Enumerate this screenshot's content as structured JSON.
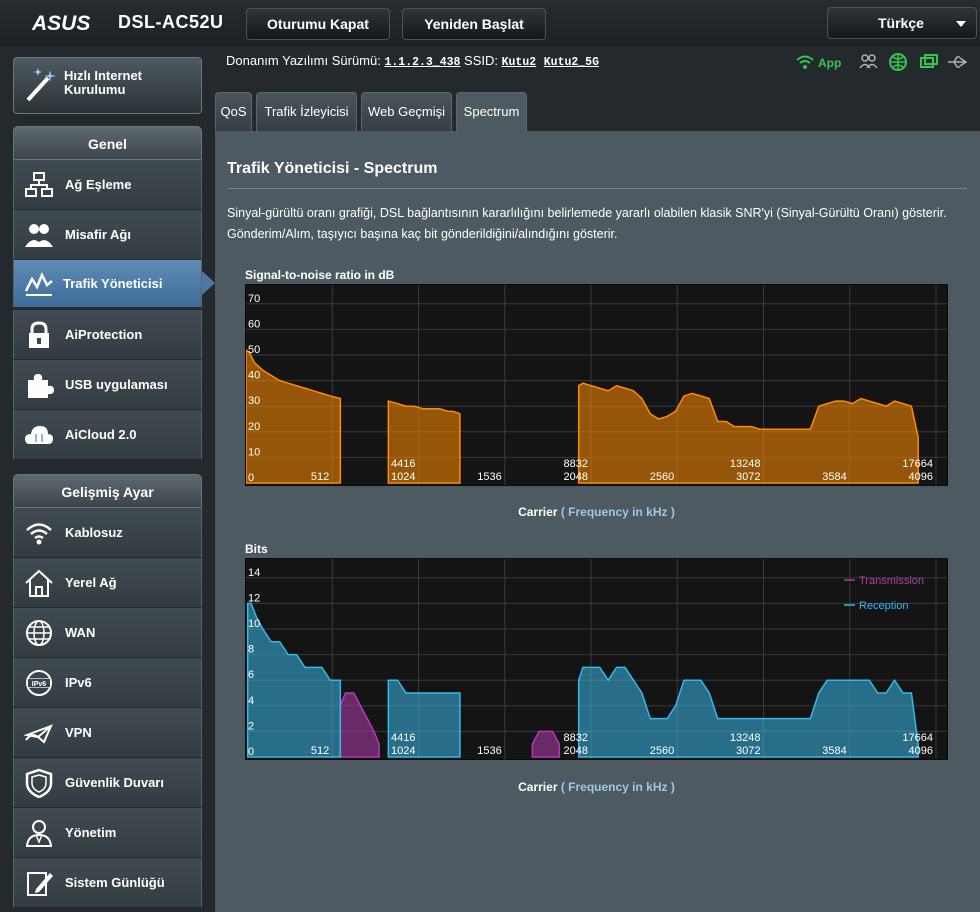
{
  "header": {
    "brand": "ASUS",
    "model": "DSL-AC52U",
    "logout_label": "Oturumu Kapat",
    "reboot_label": "Yeniden Başlat",
    "language": "Türkçe"
  },
  "firmware": {
    "label": "Donanım Yazılımı Sürümü:",
    "version": "1.1.2.3_438",
    "ssid_label": "SSID:",
    "ssid_1": "Kutu2",
    "ssid_2": "Kutu2_5G",
    "app_label": "App"
  },
  "sidebar": {
    "quick_setup": "Hızlı Internet Kurulumu",
    "general_title": "Genel",
    "general_items": [
      {
        "label": "Ağ Eşleme",
        "icon": "network-map-icon"
      },
      {
        "label": "Misafir Ağı",
        "icon": "guest-network-icon"
      },
      {
        "label": "Trafik Yöneticisi",
        "icon": "traffic-manager-icon",
        "active": true
      },
      {
        "label": "AiProtection",
        "icon": "lock-icon"
      },
      {
        "label": "USB uygulaması",
        "icon": "puzzle-icon"
      },
      {
        "label": "AiCloud 2.0",
        "icon": "cloud-icon"
      }
    ],
    "advanced_title": "Gelişmiş Ayar",
    "advanced_items": [
      {
        "label": "Kablosuz",
        "icon": "wifi-icon"
      },
      {
        "label": "Yerel Ağ",
        "icon": "home-icon"
      },
      {
        "label": "WAN",
        "icon": "globe-icon"
      },
      {
        "label": "IPv6",
        "icon": "ipv6-icon"
      },
      {
        "label": "VPN",
        "icon": "vpn-icon"
      },
      {
        "label": "Güvenlik Duvarı",
        "icon": "shield-icon"
      },
      {
        "label": "Yönetim",
        "icon": "admin-icon"
      },
      {
        "label": "Sistem Günlüğü",
        "icon": "log-icon"
      }
    ]
  },
  "tabs": [
    {
      "label": "QoS"
    },
    {
      "label": "Trafik İzleyicisi"
    },
    {
      "label": "Web Geçmişi"
    },
    {
      "label": "Spectrum",
      "active": true
    }
  ],
  "main": {
    "title": "Trafik Yöneticisi - Spectrum",
    "description": "Sinyal-gürültü oranı grafiği, DSL bağlantısının kararlılığını belirlemede yararlı olabilen klasik SNR'yi (Sinyal-Gürültü Oranı) gösterir. Gönderim/Alım, taşıyıcı başına kaç bit gönderildiğini/alındığını gösterir.",
    "carrier_label": "Carrier",
    "carrier_unit": "( Frequency in kHz )"
  },
  "chart_data": [
    {
      "type": "area",
      "title": "Signal-to-noise ratio in dB",
      "xlabel": "Carrier ( Frequency in kHz )",
      "ylim": [
        0,
        75
      ],
      "y_ticks": [
        "0",
        "10",
        "20",
        "30",
        "40",
        "50",
        "60",
        "70"
      ],
      "x_ticks": [
        "512",
        "1024",
        "1536",
        "2048",
        "2560",
        "3072",
        "3584",
        "4096"
      ],
      "freq_ticks": [
        "4416",
        "8832",
        "13248",
        "17664"
      ],
      "series": [
        {
          "color": "#ff8c00",
          "segments": [
            {
              "x": [
                0,
                20,
                50,
                100,
                150,
                200,
                250,
                300,
                350,
                400,
                450,
                500,
                560
              ],
              "y": [
                52,
                51,
                47,
                44,
                42,
                40,
                39,
                38,
                37,
                36,
                35,
                34,
                33
              ]
            },
            {
              "x": [
                845,
                900,
                950,
                1000,
                1050,
                1100,
                1150,
                1200,
                1230,
                1270
              ],
              "y": [
                32,
                31,
                30,
                30,
                29,
                29,
                29,
                28,
                28,
                27
              ]
            },
            {
              "x": [
                1975,
                2000,
                2050,
                2100,
                2150,
                2200,
                2250,
                2300,
                2350,
                2400,
                2450,
                2500,
                2550,
                2600,
                2650,
                2700,
                2750,
                2800,
                2850,
                2900,
                2950,
                3000,
                3050,
                3100,
                3150,
                3200,
                3250,
                3300,
                3350,
                3400,
                3450,
                3500,
                3550,
                3600,
                3650,
                3700,
                3750,
                3800,
                3850,
                3900,
                3950,
                3990
              ],
              "y": [
                38,
                39,
                38,
                37,
                36,
                38,
                37,
                36,
                33,
                27,
                25,
                26,
                28,
                34,
                35,
                34,
                33,
                24,
                24,
                22,
                22,
                22,
                21,
                21,
                21,
                21,
                21,
                21,
                21,
                30,
                31,
                32,
                32,
                31,
                33,
                32,
                31,
                30,
                32,
                31,
                30,
                18
              ]
            }
          ]
        }
      ]
    },
    {
      "type": "area",
      "title": "Bits",
      "xlabel": "Carrier ( Frequency in kHz )",
      "ylim": [
        0,
        15
      ],
      "y_ticks": [
        "0",
        "2",
        "4",
        "6",
        "8",
        "10",
        "12",
        "14"
      ],
      "x_ticks": [
        "512",
        "1024",
        "1536",
        "2048",
        "2560",
        "3072",
        "3584",
        "4096"
      ],
      "freq_ticks": [
        "4416",
        "8832",
        "13248",
        "17664"
      ],
      "series": [
        {
          "name": "Transmission",
          "color": "#b03cb0",
          "segments": [
            {
              "x": [
                560,
                590,
                640,
                680,
                720,
                760,
                790
              ],
              "y": [
                4,
                5,
                5,
                4,
                3,
                2,
                1
              ]
            },
            {
              "x": [
                1700,
                1740,
                1780,
                1820,
                1860
              ],
              "y": [
                1,
                2,
                2,
                2,
                1
              ]
            }
          ]
        },
        {
          "name": "Reception",
          "color": "#39b8e8",
          "segments": [
            {
              "x": [
                10,
                30,
                60,
                100,
                150,
                200,
                250,
                300,
                350,
                400,
                450,
                500,
                560
              ],
              "y": [
                12,
                12,
                11,
                10,
                9,
                9,
                8,
                8,
                7,
                7,
                7,
                6,
                6
              ]
            },
            {
              "x": [
                845,
                900,
                950,
                1000,
                1050,
                1100,
                1150,
                1200,
                1240,
                1270
              ],
              "y": [
                6,
                6,
                5,
                5,
                5,
                5,
                5,
                5,
                5,
                5
              ]
            },
            {
              "x": [
                1975,
                2000,
                2050,
                2100,
                2150,
                2200,
                2250,
                2300,
                2350,
                2400,
                2450,
                2500,
                2550,
                2600,
                2650,
                2700,
                2750,
                2800,
                2850,
                2900,
                2950,
                3000,
                3050,
                3100,
                3150,
                3200,
                3250,
                3300,
                3350,
                3400,
                3450,
                3500,
                3550,
                3600,
                3650,
                3700,
                3750,
                3800,
                3850,
                3900,
                3950,
                3990
              ],
              "y": [
                6,
                7,
                7,
                7,
                6,
                7,
                7,
                6,
                5,
                3,
                3,
                3,
                4,
                6,
                6,
                6,
                5,
                3,
                3,
                3,
                3,
                3,
                3,
                3,
                3,
                3,
                3,
                3,
                3,
                5,
                6,
                6,
                6,
                6,
                6,
                6,
                5,
                5,
                6,
                5,
                5,
                1
              ]
            }
          ]
        }
      ],
      "legend_position": "top-right"
    }
  ]
}
